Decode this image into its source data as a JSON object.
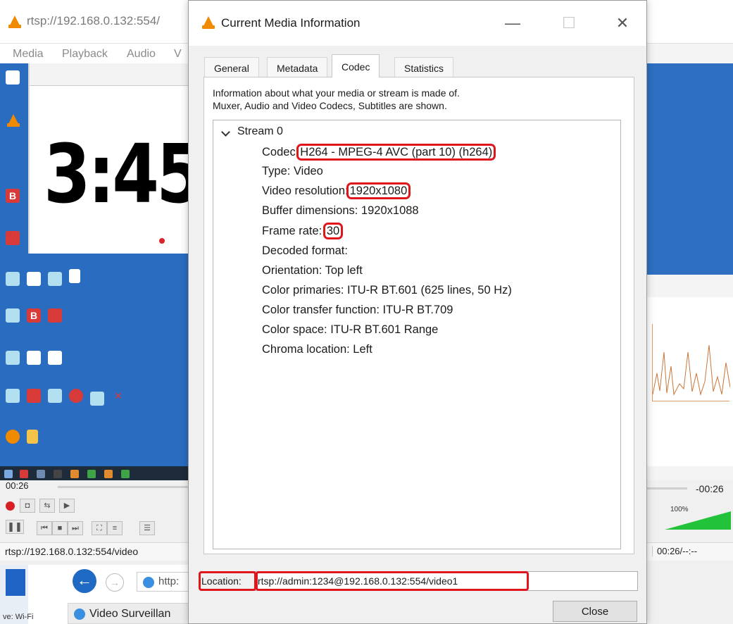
{
  "background_window": {
    "title": "rtsp://192.168.0.132:554/",
    "menu": [
      "Media",
      "Playback",
      "Audio",
      "V"
    ],
    "remote_clock": "3:45:",
    "elapsed": "00:26",
    "remaining": "-00:26",
    "status_url": "rtsp://192.168.0.132:554/video",
    "status_time": "00:26/--:--",
    "volume": "100%"
  },
  "browser": {
    "address": "http:",
    "tab_title": "Video Surveillan",
    "side_text": "ve: Wi-Fi"
  },
  "dialog": {
    "title": "Current Media Information",
    "minimize_glyph": "—",
    "maximize_glyph": "☐",
    "close_glyph": "✕",
    "tabs": [
      "General",
      "Metadata",
      "Codec",
      "Statistics"
    ],
    "active_tab": "Codec",
    "info_text_1": "Information about what your media or stream is made of.",
    "info_text_2": "Muxer, Audio and Video Codecs, Subtitles are shown.",
    "stream": {
      "label": "Stream 0",
      "codec_label": "Codec:",
      "codec_value": "H264 - MPEG-4 AVC (part 10) (h264)",
      "type": "Type: Video",
      "resolution_label": "Video resolution:",
      "resolution_value": "1920x1080",
      "buffer": "Buffer dimensions: 1920x1088",
      "framerate_label": "Frame rate:",
      "framerate_value": "30",
      "decoded": "Decoded format:",
      "orientation": "Orientation: Top left",
      "primaries": "Color primaries: ITU-R BT.601 (625 lines, 50 Hz)",
      "transfer": "Color transfer function: ITU-R BT.709",
      "space": "Color space: ITU-R BT.601 Range",
      "chroma": "Chroma location: Left"
    },
    "location_label": "Location:",
    "location_value": "rtsp://admin:1234@192.168.0.132:554/video1",
    "close_label": "Close"
  },
  "colors": {
    "highlight": "#e0161d",
    "vlc_orange": "#f08a00",
    "desktop_blue": "#2a6cbf"
  }
}
